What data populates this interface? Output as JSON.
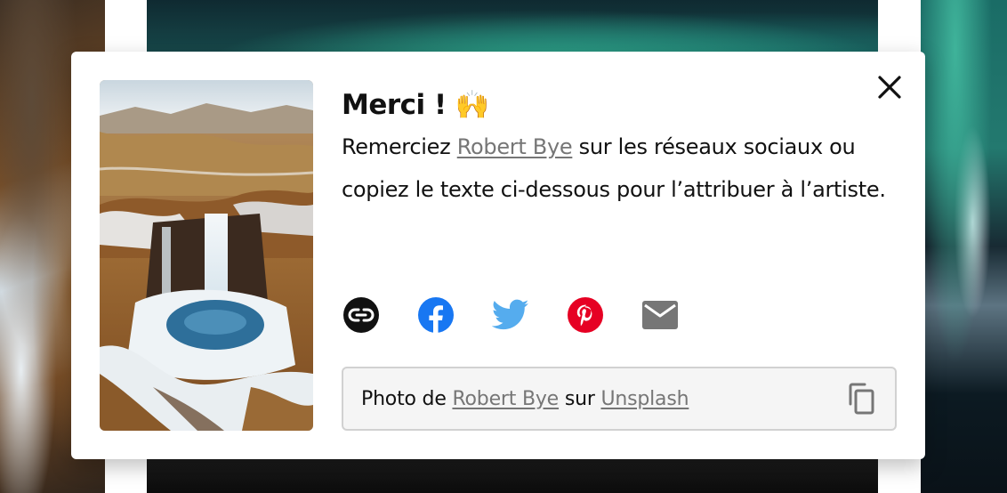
{
  "modal": {
    "title": "Merci !",
    "title_emoji": "🙌",
    "description": {
      "before": "Remerciez ",
      "artist": "Robert Bye",
      "after": " sur les réseaux sociaux ou copiez le texte ci-dessous pour l’attribuer à l’artiste."
    },
    "close_icon": "close-icon",
    "share": [
      {
        "icon": "link-icon",
        "color": "#111111"
      },
      {
        "icon": "facebook-icon",
        "color": "#1877f2"
      },
      {
        "icon": "twitter-icon",
        "color": "#55acee"
      },
      {
        "icon": "pinterest-icon",
        "color": "#e60023"
      },
      {
        "icon": "email-icon",
        "color": "#767676"
      }
    ],
    "attribution": {
      "prefix": "Photo de ",
      "artist": "Robert Bye",
      "middle": " sur ",
      "site": "Unsplash",
      "copy_icon": "copy-icon"
    }
  },
  "colors": {
    "text": "#111111",
    "link": "#767676",
    "field_bg": "#f5f5f5",
    "field_border": "#d1d1d1"
  }
}
